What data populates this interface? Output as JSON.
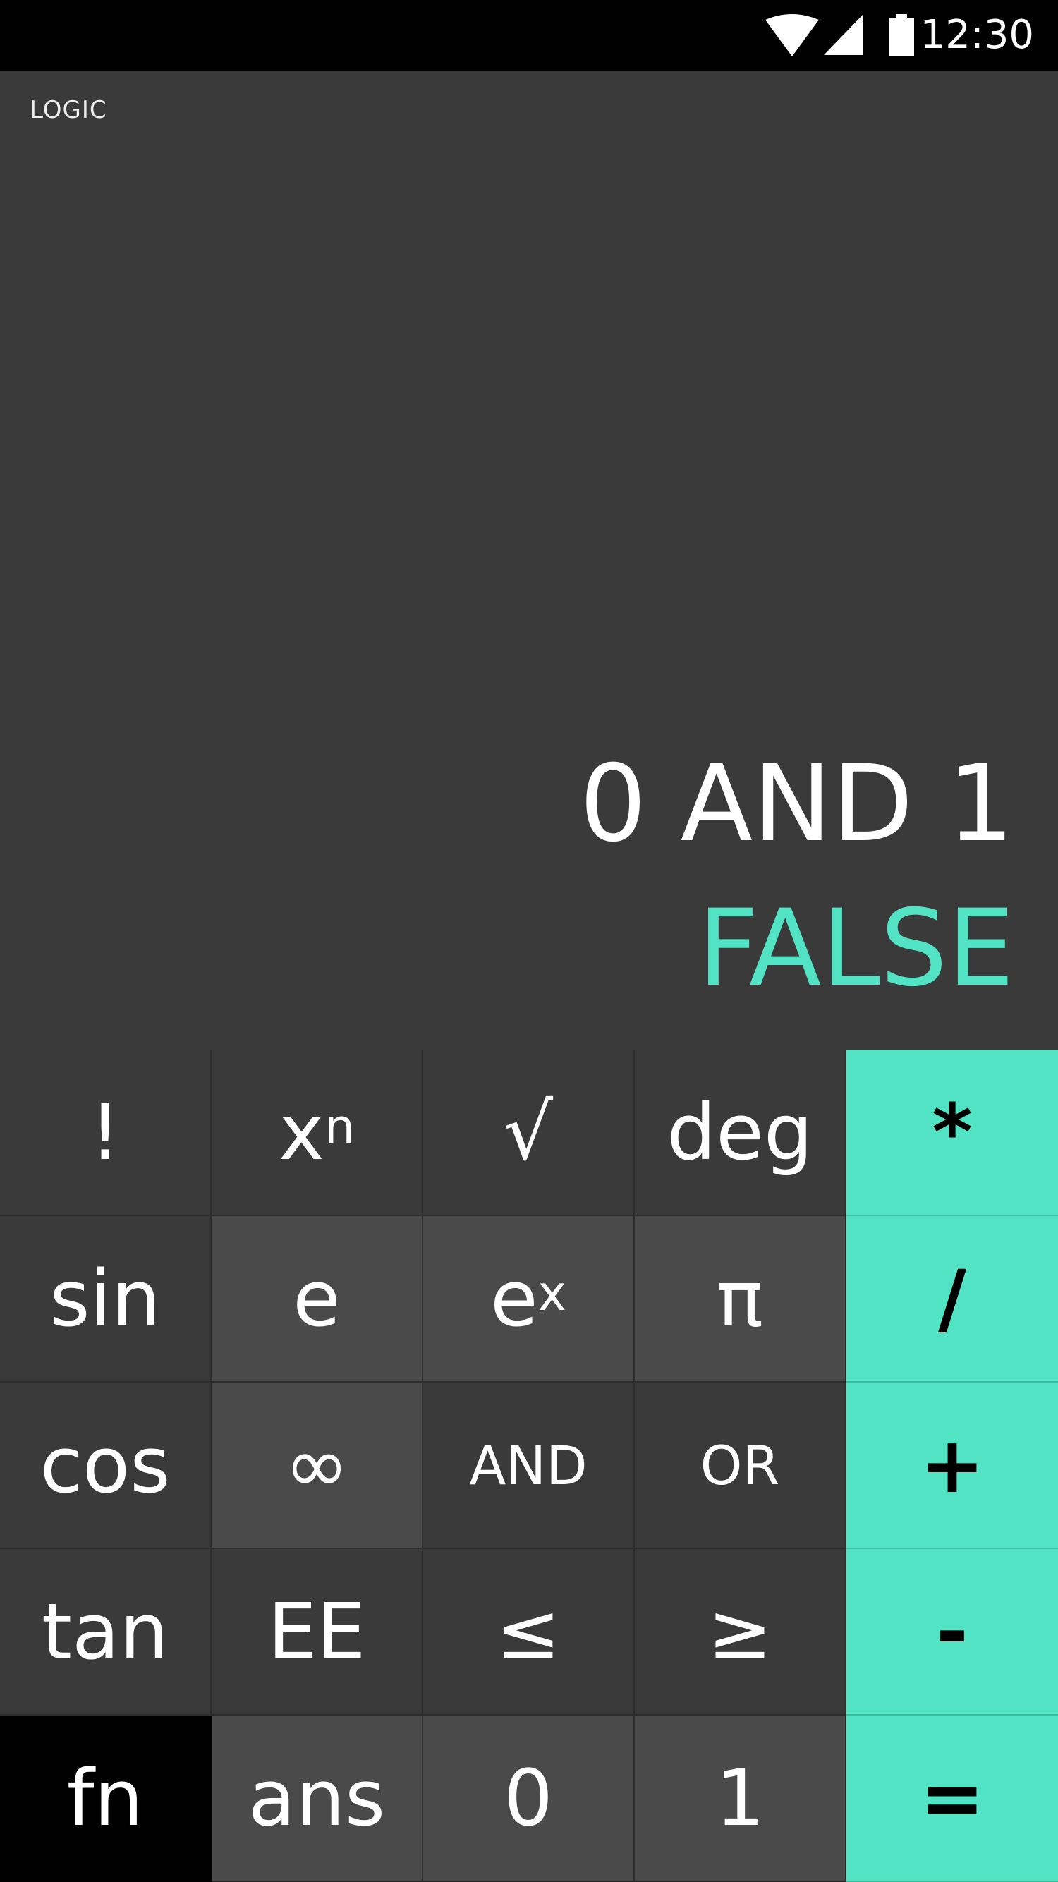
{
  "status_bar": {
    "time": "12:30",
    "icons": [
      "wifi-icon",
      "signal-icon",
      "battery-icon"
    ]
  },
  "display": {
    "mode": "LOGIC",
    "expression": "0 AND 1",
    "result": "FALSE"
  },
  "colors": {
    "accent": "#51e3c3",
    "display_bg": "#393a39",
    "key_dark": "#393a39",
    "key_mid": "#4a4a4a",
    "key_black": "#000000"
  },
  "keypad": {
    "row1": {
      "factorial": "!",
      "power_base": "x",
      "power_exp": "n",
      "sqrt": "√",
      "deg": "deg",
      "multiply": "*"
    },
    "row2": {
      "sin": "sin",
      "e": "e",
      "exp_base": "e",
      "exp_exp": "x",
      "pi": "π",
      "divide": "/"
    },
    "row3": {
      "cos": "cos",
      "infinity": "∞",
      "and": "AND",
      "or": "OR",
      "plus": "+"
    },
    "row4": {
      "tan": "tan",
      "ee": "EE",
      "lte": "≤",
      "gte": "≥",
      "minus": "-"
    },
    "row5": {
      "fn": "fn",
      "ans": "ans",
      "zero": "0",
      "one": "1",
      "equals": "="
    }
  }
}
